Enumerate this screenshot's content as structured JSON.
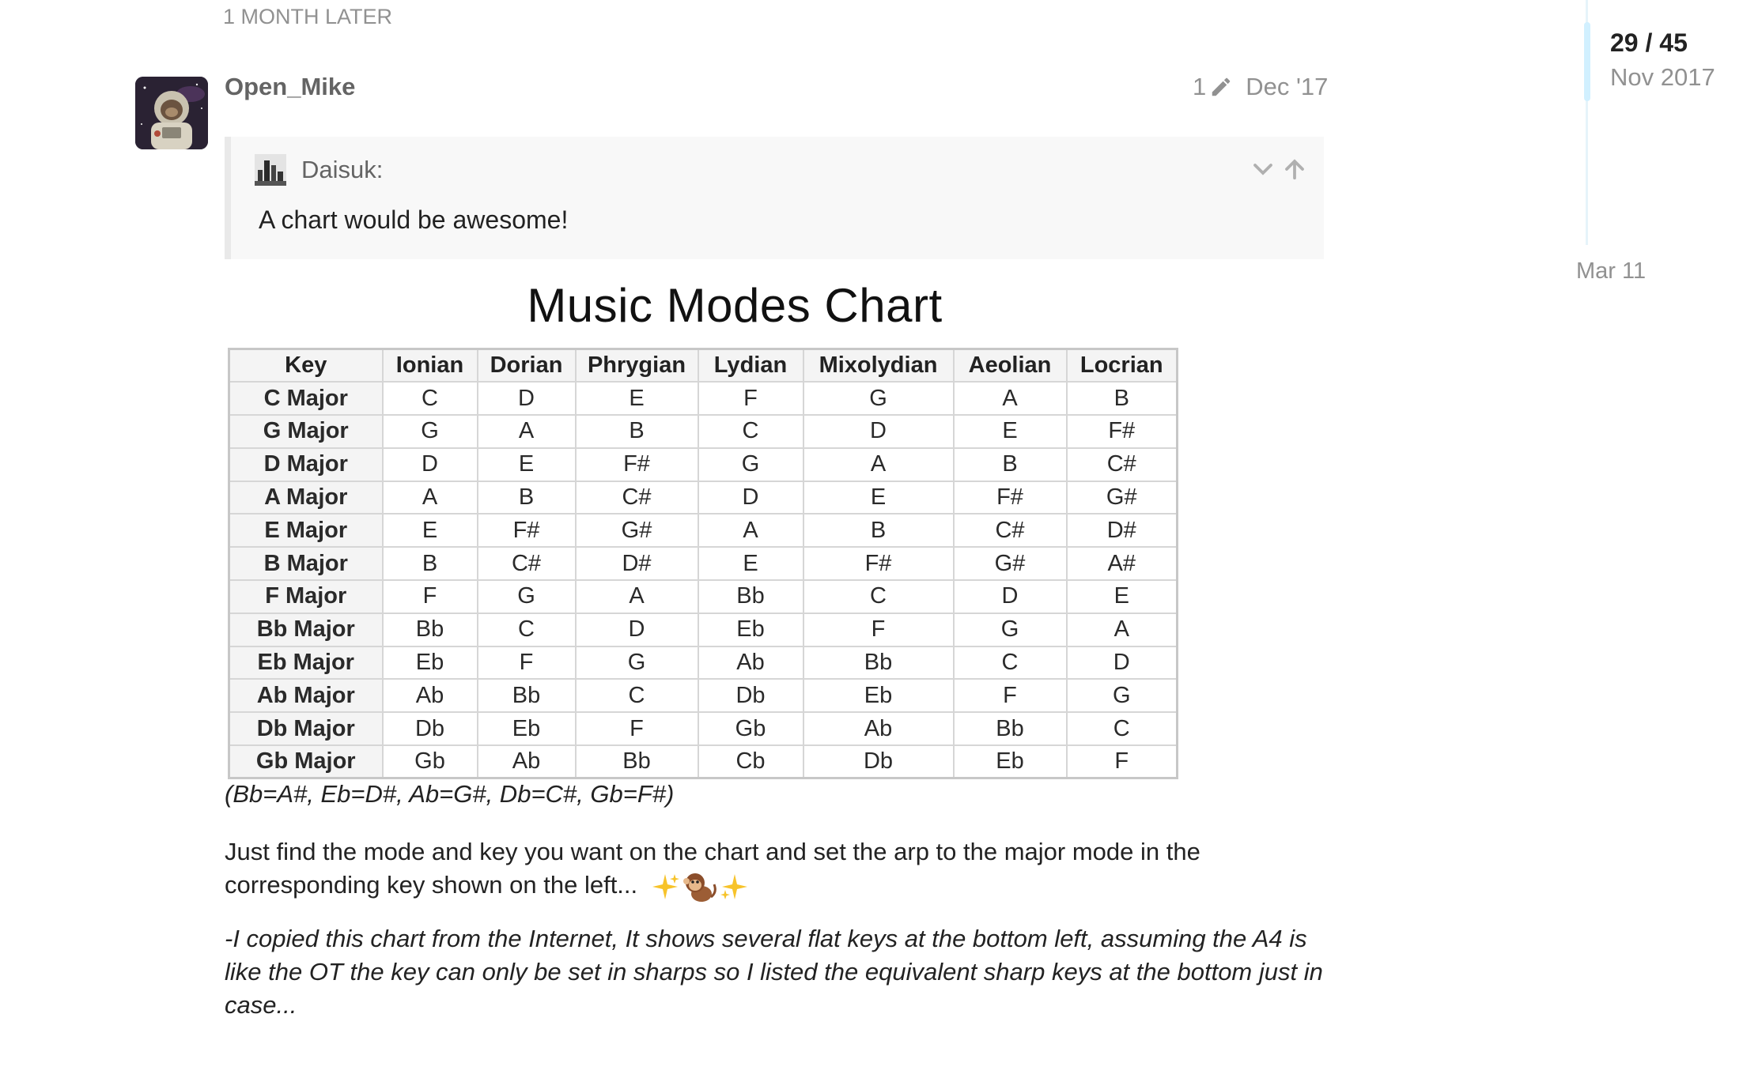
{
  "time_gap": "1 MONTH LATER",
  "post": {
    "username": "Open_Mike",
    "edit_count": "1",
    "date": "Dec '17"
  },
  "quote": {
    "author": "Daisuk:",
    "text": "A chart would be awesome!"
  },
  "chart": {
    "title": "Music Modes Chart",
    "headers": [
      "Key",
      "Ionian",
      "Dorian",
      "Phrygian",
      "Lydian",
      "Mixolydian",
      "Aeolian",
      "Locrian"
    ],
    "rows": [
      [
        "C Major",
        "C",
        "D",
        "E",
        "F",
        "G",
        "A",
        "B"
      ],
      [
        "G Major",
        "G",
        "A",
        "B",
        "C",
        "D",
        "E",
        "F#"
      ],
      [
        "D Major",
        "D",
        "E",
        "F#",
        "G",
        "A",
        "B",
        "C#"
      ],
      [
        "A Major",
        "A",
        "B",
        "C#",
        "D",
        "E",
        "F#",
        "G#"
      ],
      [
        "E Major",
        "E",
        "F#",
        "G#",
        "A",
        "B",
        "C#",
        "D#"
      ],
      [
        "B Major",
        "B",
        "C#",
        "D#",
        "E",
        "F#",
        "G#",
        "A#"
      ],
      [
        "F Major",
        "F",
        "G",
        "A",
        "Bb",
        "C",
        "D",
        "E"
      ],
      [
        "Bb Major",
        "Bb",
        "C",
        "D",
        "Eb",
        "F",
        "G",
        "A"
      ],
      [
        "Eb Major",
        "Eb",
        "F",
        "G",
        "Ab",
        "Bb",
        "C",
        "D"
      ],
      [
        "Ab Major",
        "Ab",
        "Bb",
        "C",
        "Db",
        "Eb",
        "F",
        "G"
      ],
      [
        "Db Major",
        "Db",
        "Eb",
        "F",
        "Gb",
        "Ab",
        "Bb",
        "C"
      ],
      [
        "Gb Major",
        "Gb",
        "Ab",
        "Bb",
        "Cb",
        "Db",
        "Eb",
        "F"
      ]
    ]
  },
  "equivalents": "(Bb=A#, Eb=D#, Ab=G#, Db=C#, Gb=F#)",
  "paragraph1": "Just find the mode and key you want on the chart and set the arp to the major mode in the corresponding key shown on the left...",
  "paragraph2": "-I copied this chart from the Internet, It shows several flat keys at the bottom left, assuming the A4 is like the OT the key can only be set in sharps so I listed the equivalent sharp keys at the bottom just in case...",
  "emojis": [
    "sparkles-icon",
    "monkey-icon",
    "sparkles-icon"
  ],
  "timeline": {
    "position": "29 / 45",
    "current_date": "Nov 2017",
    "end_date": "Mar 11",
    "progress": 0.644
  },
  "colors": {
    "muted": "#919191",
    "username": "#646464",
    "quote_bg": "#f8f8f8",
    "timeline_handle": "#d1f0ff"
  }
}
